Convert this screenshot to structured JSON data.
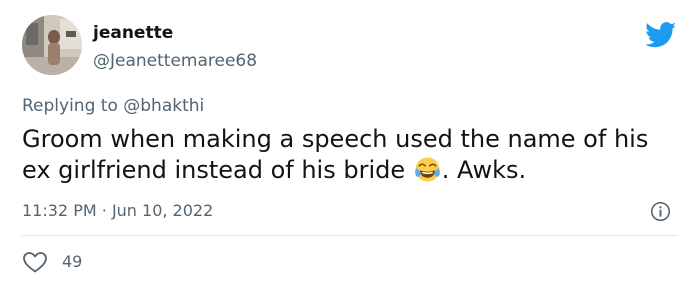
{
  "author": {
    "display_name": "jeanette",
    "handle": "@Jeanettemaree68",
    "avatar_icon": "profile-photo"
  },
  "brand": {
    "icon": "twitter-bird-icon",
    "color": "#1d9bf0"
  },
  "reply": {
    "prefix": "Replying to",
    "target": "@bhakthi"
  },
  "tweet": {
    "text_before_emoji": "Groom when making a speech used the name of his ex girlfriend instead of his bride",
    "emoji": "face-with-tears-of-joy",
    "text_after_emoji": ". Awks."
  },
  "meta": {
    "time": "11:32 PM",
    "separator": "·",
    "date": "Jun 10, 2022",
    "info_icon": "info-icon"
  },
  "engagement": {
    "like_icon": "heart-icon",
    "like_count": "49"
  },
  "colors": {
    "text_primary": "#0f1419",
    "text_secondary": "#536471",
    "divider": "#e1e8ed"
  }
}
